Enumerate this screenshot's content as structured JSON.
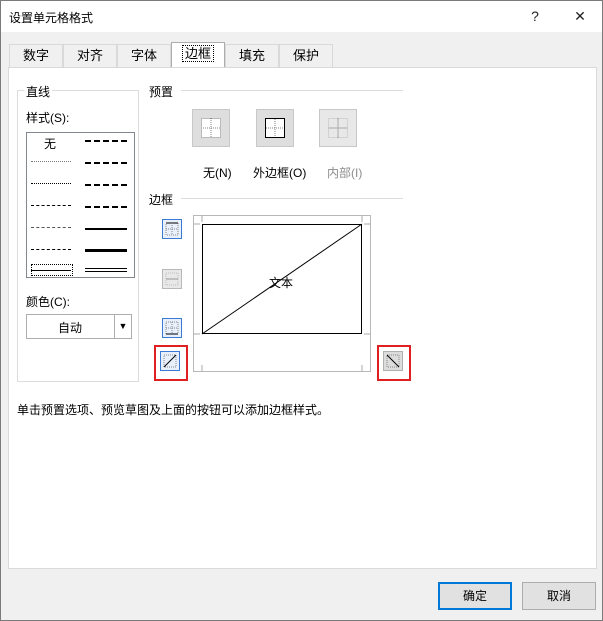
{
  "window": {
    "title": "设置单元格格式",
    "help_label": "?",
    "close_label": "✕"
  },
  "tabs": [
    {
      "label": "数字"
    },
    {
      "label": "对齐"
    },
    {
      "label": "字体"
    },
    {
      "label": "边框",
      "active": true
    },
    {
      "label": "填充"
    },
    {
      "label": "保护"
    }
  ],
  "line_group": {
    "title": "直线",
    "style_label": "样式(S):",
    "style_none": "无",
    "color_label": "颜色(C):",
    "color_value": "自动"
  },
  "presets": {
    "title": "预置",
    "none_label": "无(N)",
    "outline_label": "外边框(O)",
    "inside_label": "内部(I)"
  },
  "border": {
    "title": "边框",
    "preview_text": "文本"
  },
  "hint_text": "单击预置选项、预览草图及上面的按钮可以添加边框样式。",
  "buttons": {
    "ok_label": "确定",
    "cancel_label": "取消"
  },
  "colors": {
    "accent": "#0078d7",
    "highlight": "#e02020"
  }
}
